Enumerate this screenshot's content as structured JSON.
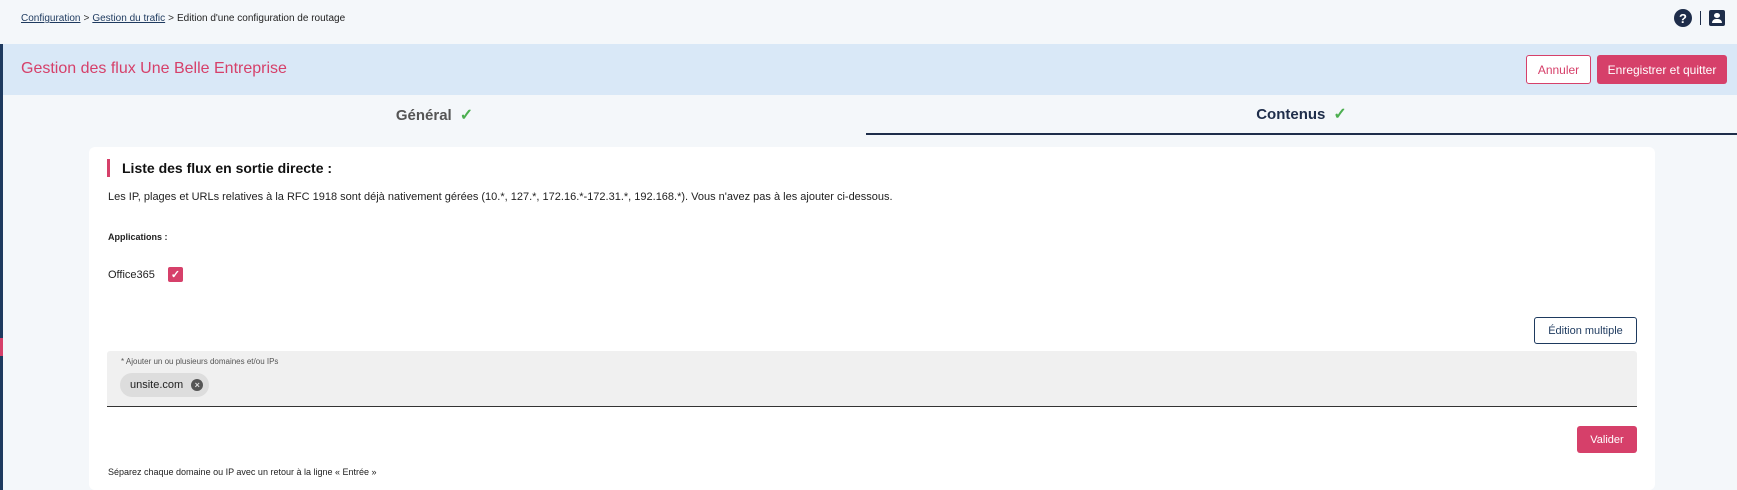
{
  "breadcrumb": {
    "item1": "Configuration",
    "item2": "Gestion du trafic",
    "current": "Edition d'une configuration de routage",
    "separator": ">"
  },
  "header": {
    "title": "Gestion des flux Une Belle Entreprise",
    "cancel_label": "Annuler",
    "save_label": "Enregistrer et quitter"
  },
  "tabs": [
    {
      "label": "Général",
      "completed": true,
      "active": false
    },
    {
      "label": "Contenus",
      "completed": true,
      "active": true
    }
  ],
  "section": {
    "title": "Liste des flux en sortie directe :",
    "info": "Les IP, plages et URLs relatives à la RFC 1918 sont déjà nativement gérées (10.*, 127.*, 172.16.*-172.31.*, 192.168.*). Vous n'avez pas à les ajouter ci-dessous.",
    "applications_label": "Applications :",
    "applications": [
      {
        "name": "Office365",
        "checked": true
      }
    ],
    "multi_edit_label": "Édition multiple",
    "field_label": "* Ajouter un ou plusieurs domaines et/ou IPs",
    "chips": [
      "unsite.com"
    ],
    "validate_label": "Valider",
    "hint": "Séparez chaque domaine ou IP avec un retour à la ligne « Entrée »"
  },
  "icons": {
    "help": "help-circle-icon",
    "user": "user-account-icon",
    "check": "check-icon",
    "chip_remove": "close-circle-icon"
  },
  "colors": {
    "accent": "#d6406a",
    "navy": "#1e2d4a",
    "header_band": "#d9e8f7",
    "success": "#4caf50"
  }
}
